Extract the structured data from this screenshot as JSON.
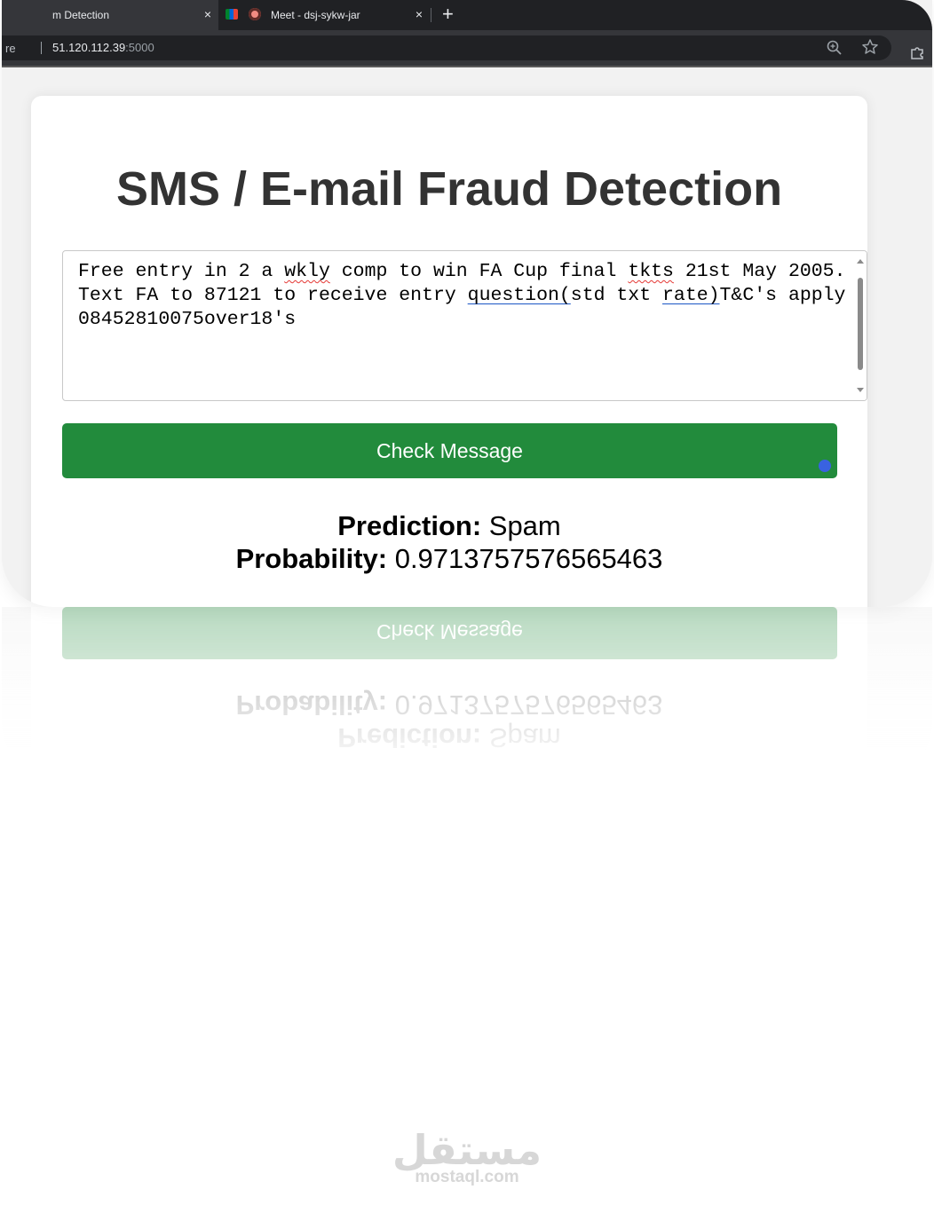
{
  "browser": {
    "tabs": [
      {
        "title": "m Detection",
        "close": "×"
      },
      {
        "title": "Meet - dsj-sykw-jar",
        "close": "×"
      }
    ],
    "new_tab": "+",
    "security_label": "re",
    "url_host": "51.120.112.39",
    "url_port": ":5000"
  },
  "page": {
    "title": "SMS / E-mail Fraud Detection",
    "message_parts": [
      "Free entry in 2 a ",
      "wkly",
      " comp to win FA Cup final ",
      "tkts",
      " 21st May 2005.\nText FA to 87121 to receive entry ",
      "question(",
      "std txt ",
      "rate)",
      "T&C's apply\n08452810075over18's"
    ],
    "check_button": "Check Message",
    "prediction_label": "Prediction:",
    "prediction_value": "Spam",
    "probability_label": "Probability:",
    "probability_value": "0.9713757576565463"
  },
  "watermark": {
    "arabic": "مستقل",
    "latin": "mostaql.com"
  }
}
